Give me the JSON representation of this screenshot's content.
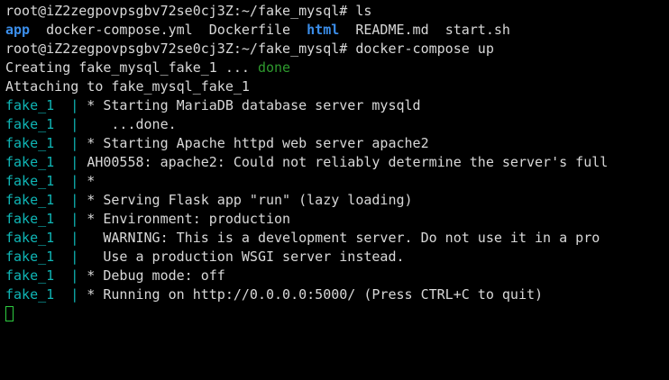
{
  "terminal": {
    "colors": {
      "background": "#000000",
      "text": "#d8d8d8",
      "directory": "#3b8eea",
      "done": "#2e9a2e",
      "container_prefix": "#0fb5b5",
      "cursor": "#2ecc40"
    },
    "prompt_1": {
      "prompt": "root@iZ2zegpovpsgbv72se0cj3Z:~/fake_mysql#",
      "command": "ls"
    },
    "ls_output": {
      "item_1": "app",
      "item_2": "docker-compose.yml",
      "item_3": "Dockerfile",
      "item_4": "html",
      "item_5": "README.md",
      "item_6": "start.sh"
    },
    "prompt_2": {
      "prompt": "root@iZ2zegpovpsgbv72se0cj3Z:~/fake_mysql#",
      "command": "docker-compose up"
    },
    "creating": {
      "text": "Creating fake_mysql_fake_1 ...",
      "status": "done"
    },
    "attaching": "Attaching to fake_mysql_fake_1",
    "container_prefix": "fake_1  |",
    "logs": [
      " * Starting MariaDB database server mysqld",
      "    ...done.",
      " * Starting Apache httpd web server apache2",
      "AH00558: apache2: Could not reliably determine the server's full",
      " *",
      " * Serving Flask app \"run\" (lazy loading)",
      " * Environment: production",
      "   WARNING: This is a development server. Do not use it in a pro",
      "   Use a production WSGI server instead.",
      " * Debug mode: off",
      " * Running on http://0.0.0.0:5000/ (Press CTRL+C to quit)"
    ]
  }
}
